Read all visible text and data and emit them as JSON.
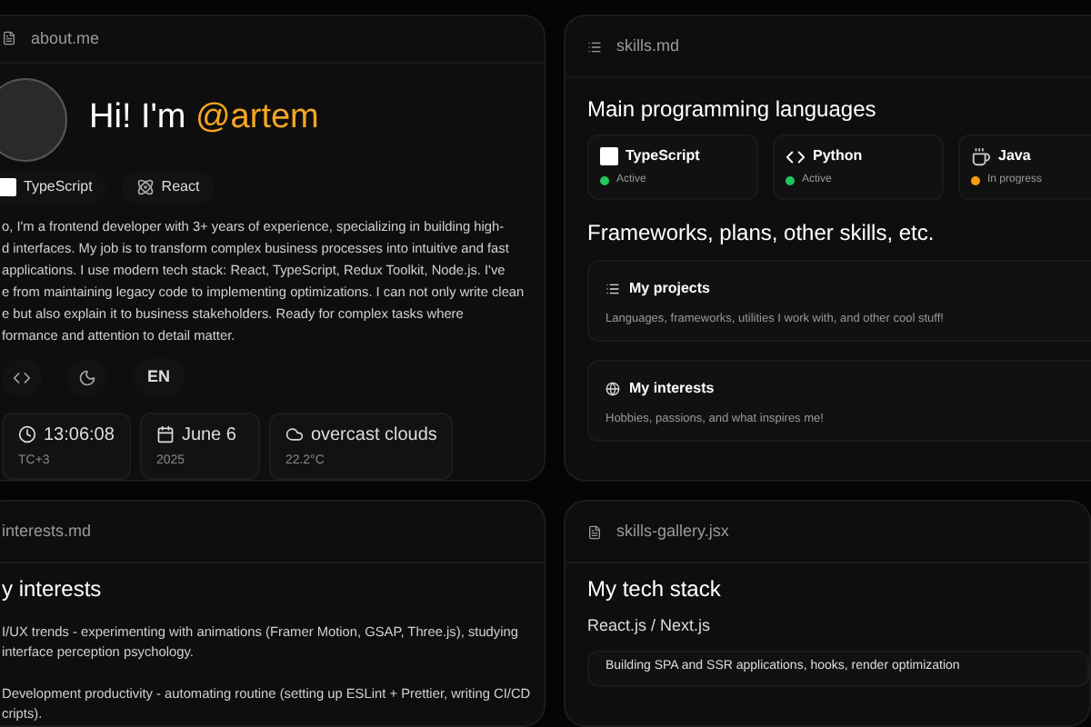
{
  "about": {
    "file": "about.me",
    "greeting": "Hi! I'm",
    "handle": "@artem",
    "tags": [
      {
        "label": "TypeScript",
        "kind": "ts"
      },
      {
        "label": "React",
        "kind": "react"
      }
    ],
    "bio_lines": [
      "o, I'm a frontend developer with 3+ years of experience, specializing in building high-",
      "d interfaces. My job is to transform complex business processes into intuitive and fast",
      "applications. I use modern tech stack: React, TypeScript, Redux Toolkit, Node.js. I've",
      "e from maintaining legacy code to implementing optimizations. I can not only write clean",
      "e but also explain it to business stakeholders. Ready for complex tasks where",
      "formance and attention to detail matter."
    ],
    "controls": [
      {
        "kind": "icon"
      },
      {
        "kind": "moon"
      },
      {
        "kind": "text",
        "label": "EN"
      }
    ],
    "info": [
      {
        "kind": "clock",
        "value": "13:06:08",
        "sub": "TC+3"
      },
      {
        "kind": "calendar",
        "value": "June 6",
        "sub": "2025"
      },
      {
        "kind": "cloud",
        "value": "overcast clouds",
        "sub": "22.2°C"
      }
    ]
  },
  "skills": {
    "file": "skills.md",
    "heading": "Main programming languages",
    "languages": [
      {
        "name": "TypeScript",
        "kind": "ts",
        "status": "Active",
        "color": "#22c55e"
      },
      {
        "name": "Python",
        "kind": "python",
        "status": "Active",
        "color": "#22c55e"
      },
      {
        "name": "Java",
        "kind": "java",
        "status": "In progress",
        "color": "#f59e0b"
      }
    ],
    "heading2": "Frameworks, plans, other skills, etc.",
    "cards": [
      {
        "kind": "list",
        "title": "My projects",
        "text": "Languages, frameworks, utilities I work with, and other cool stuff!"
      },
      {
        "kind": "globe",
        "title": "My interests",
        "text": "Hobbies, passions, and what inspires me!"
      }
    ]
  },
  "interests": {
    "file": "interests.md",
    "heading": "y interests",
    "items": [
      [
        "I/UX trends - experimenting with animations (Framer Motion, GSAP, Three.js), studying",
        "interface perception psychology."
      ],
      [
        "Development productivity - automating routine (setting up ESLint + Prettier, writing CI/CD",
        "cripts)."
      ]
    ]
  },
  "gallery": {
    "file": "skills-gallery.jsx",
    "heading": "My tech stack",
    "subheading": "React.js / Next.js",
    "text": "Building SPA and SSR applications, hooks, render optimization"
  }
}
